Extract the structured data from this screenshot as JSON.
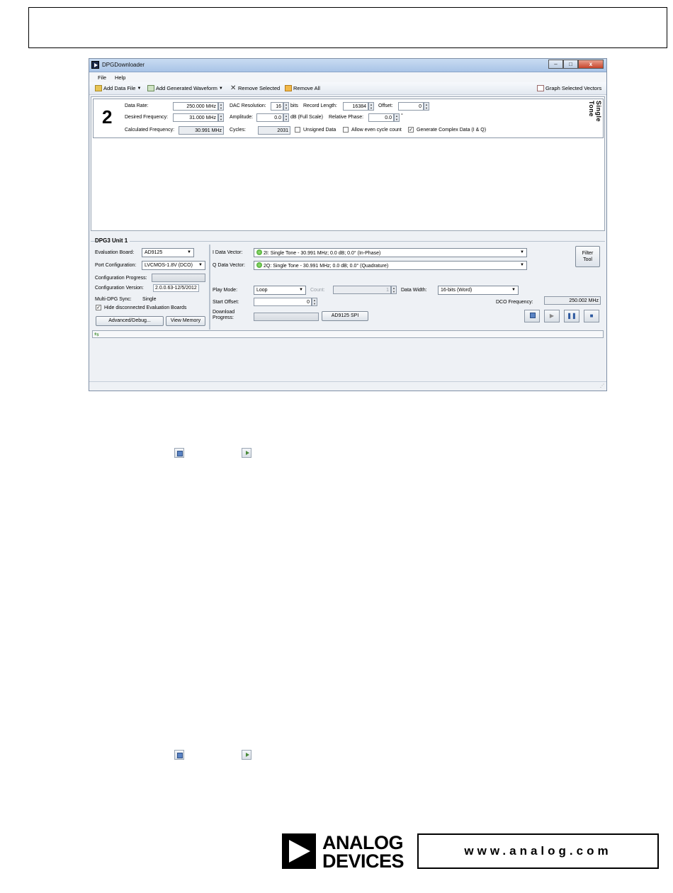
{
  "window": {
    "title": "DPGDownloader",
    "btn_min": "–",
    "btn_max": "□",
    "btn_close": "x"
  },
  "menu": [
    "File",
    "Help"
  ],
  "toolbar": {
    "add_data_file": "Add Data File",
    "add_generated_waveform": "Add Generated Waveform",
    "remove_selected": "Remove Selected",
    "remove_all": "Remove All",
    "graph_selected_vectors": "Graph Selected Vectors"
  },
  "waveform": {
    "number": "2",
    "type_label": "Single Tone",
    "data_rate_label": "Data Rate:",
    "data_rate": "250.000 MHz",
    "desired_freq_label": "Desired Frequency:",
    "desired_freq": "31.000 MHz",
    "calc_freq_label": "Calculated Frequency:",
    "calc_freq": "30.991 MHz",
    "dac_res_label": "DAC Resolution:",
    "dac_res": "16",
    "dac_res_unit": "bits",
    "record_length_label": "Record Length:",
    "record_length": "16384",
    "offset_label": "Offset:",
    "offset": "0",
    "amplitude_label": "Amplitude:",
    "amplitude": "0.0",
    "amplitude_unit": "dB (Full Scale)",
    "rel_phase_label": "Relative Phase:",
    "rel_phase": "0.0",
    "rel_phase_unit": "°",
    "cycles_label": "Cycles:",
    "cycles": "2031",
    "unsigned_label": "Unsigned Data",
    "even_cycle_label": "Allow even cycle count",
    "complex_label": "Generate Complex Data (I & Q)",
    "complex_checked": "✓"
  },
  "unit": {
    "title": "DPG3 Unit 1",
    "eval_board_label": "Evaluation Board:",
    "eval_board": "AD9125",
    "port_config_label": "Port Configuration:",
    "port_config": "LVCMOS-1.8V (DCO)",
    "config_progress_label": "Configuration Progress:",
    "config_version_label": "Configuration Version:",
    "config_version": "2.0.0.63-12/5/2012",
    "multi_sync_label": "Multi-DPG Sync:",
    "multi_sync": "Single",
    "hide_disconnected_label": "Hide disconnected Evaluation Boards",
    "hide_checked": "✓",
    "advanced_btn": "Advanced/Debug...",
    "view_memory_btn": "View Memory",
    "i_vector_label": "I Data Vector:",
    "i_vector": "2I: Single Tone - 30.991 MHz; 0.0 dB; 0.0° (In-Phase)",
    "q_vector_label": "Q Data Vector:",
    "q_vector": "2Q: Single Tone - 30.991 MHz; 0.0 dB; 0.0° (Quadrature)",
    "filter_tool_btn_1": "Filter",
    "filter_tool_btn_2": "Tool",
    "play_mode_label": "Play Mode:",
    "play_mode": "Loop",
    "count_label": "Count:",
    "count": "1",
    "data_width_label": "Data Width:",
    "data_width": "16-bits (Word)",
    "start_offset_label": "Start Offset:",
    "start_offset": "0",
    "dco_freq_label": "DCO Frequency:",
    "dco_freq": "250.002 MHz",
    "download_progress_label_1": "Download",
    "download_progress_label_2": "Progress:",
    "spi_btn": "AD9125 SPI"
  },
  "logo": {
    "line1": "ANALOG",
    "line2": "DEVICES",
    "url": "www.analog.com"
  },
  "icons": [
    "download-icon",
    "play-icon"
  ]
}
